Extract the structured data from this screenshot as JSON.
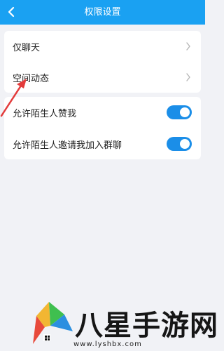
{
  "header": {
    "title": "权限设置",
    "back_icon": "chevron-left-icon"
  },
  "group1": {
    "items": [
      {
        "label": "仅聊天",
        "icon": "chevron-right-icon"
      },
      {
        "label": "空间动态",
        "icon": "chevron-right-icon"
      }
    ]
  },
  "group2": {
    "items": [
      {
        "label": "允许陌生人赞我",
        "enabled": true
      },
      {
        "label": "允许陌生人邀请我加入群聊",
        "enabled": true
      }
    ]
  },
  "watermark": {
    "text": "八星手游网",
    "url": "www.lyshbx.com"
  },
  "colors": {
    "header": "#1aa1f2",
    "toggle": "#1b8ee8",
    "arrow": "#e33b3b",
    "background": "#f1f2f6"
  }
}
